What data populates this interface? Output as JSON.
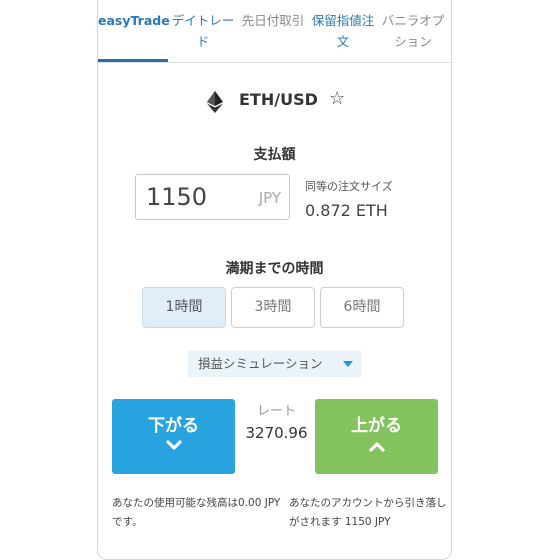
{
  "tabs": [
    {
      "label": "easyTrade"
    },
    {
      "label": "デイトレード"
    },
    {
      "label": "先日付取引"
    },
    {
      "label": "保留指値注文"
    },
    {
      "label": "バニラオプション"
    }
  ],
  "symbol": {
    "pair": "ETH/USD",
    "icon": "ethereum-icon"
  },
  "payment": {
    "heading": "支払額",
    "value": "1150",
    "unit": "JPY",
    "equivalent_label": "同等の注文サイズ",
    "equivalent_value": "0.872 ETH"
  },
  "expiry": {
    "heading": "満期までの時間",
    "options": [
      "1時間",
      "3時間",
      "6時間"
    ],
    "selected": "1時間"
  },
  "simulation": {
    "label": "損益シミュレーション"
  },
  "trade": {
    "down_label": "下がる",
    "up_label": "上がる",
    "rate_label": "レート",
    "rate_value": "3270.96"
  },
  "notes": {
    "left": "あなたの使用可能な残高は0.00 JPYです。",
    "right": "あなたのアカウントから引き落しがされます 1150 JPY"
  },
  "colors": {
    "accent": "#2a79b8",
    "down": "#27a4e0",
    "up": "#84c25d",
    "sim_bg": "#eaf3fa"
  }
}
